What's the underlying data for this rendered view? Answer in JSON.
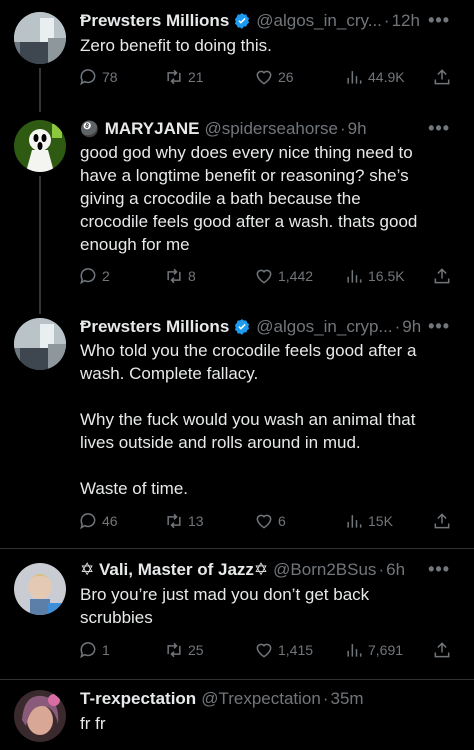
{
  "tweets": [
    {
      "name": "Ᵽrewsters Millions",
      "handle": "@algos_in_cry...",
      "time": "12h",
      "verified": true,
      "text": "Zero benefit to doing this.",
      "replies": "78",
      "reposts": "21",
      "likes": "26",
      "views": "44.9K"
    },
    {
      "name": "MARYJANE",
      "name_prefix": "🎱",
      "handle": "@spiderseahorse",
      "time": "9h",
      "verified": false,
      "text": "good god why does every nice thing need to\nhave a longtime benefit or reasoning? she’s\ngiving a crocodile a bath because the\ncrocodile feels good after a wash. thats good\nenough for me",
      "replies": "2",
      "reposts": "8",
      "likes": "1,442",
      "views": "16.5K"
    },
    {
      "name": "Ᵽrewsters Millions",
      "handle": "@algos_in_cryp...",
      "time": "9h",
      "verified": true,
      "text": "Who told you the crocodile feels good after a\nwash. Complete fallacy.\n\nWhy the fuck would you wash an animal that\nlives outside and rolls around in mud.\n\nWaste of time.",
      "replies": "46",
      "reposts": "13",
      "likes": "6",
      "views": "15K"
    },
    {
      "name": "✡ Vali, Master of Jazz✡",
      "handle": "@Born2BSus",
      "time": "6h",
      "verified": false,
      "text": "Bro you’re just mad you don’t get back\nscrubbies",
      "replies": "1",
      "reposts": "25",
      "likes": "1,415",
      "views": "7,691"
    },
    {
      "name": "T-rexpectation",
      "handle": "@Trexpectation",
      "time": "35m",
      "verified": false,
      "text": "fr fr"
    }
  ],
  "ui": {
    "more": "•••",
    "dot": "·"
  },
  "colors": {
    "background": "#000000",
    "text": "#e7e9ea",
    "muted": "#71767b",
    "verified": "#1d9bf0",
    "thread_line": "#333639"
  }
}
